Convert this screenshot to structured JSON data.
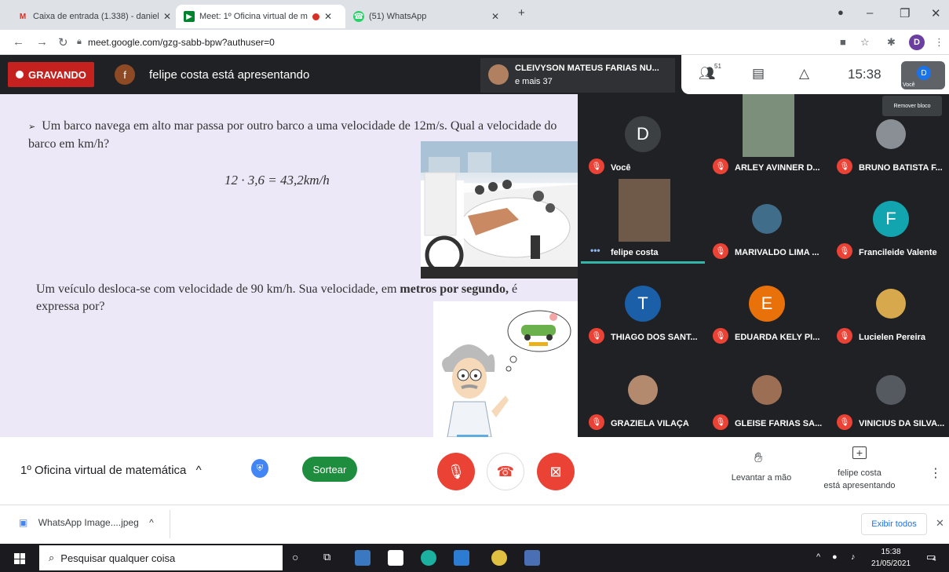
{
  "browser": {
    "tabs": [
      {
        "title": "Caixa de entrada (1.338) - daniel",
        "favicon": "gmail-icon"
      },
      {
        "title": "Meet: 1º Oficina virtual de m",
        "favicon": "meet-icon"
      },
      {
        "title": "(51) WhatsApp",
        "favicon": "whatsapp-icon"
      }
    ],
    "url": "meet.google.com/gzg-sabb-bpw?authuser=0",
    "profile_initial": "D"
  },
  "meet_top": {
    "recording_label": "GRAVANDO",
    "presenter_initial": "f",
    "presenting_text": "felipe costa está apresentando",
    "speaker_name": "CLEIVYSON MATEUS FARIAS NU...",
    "speaker_more": "e mais 37",
    "participant_count": "51",
    "clock": "15:38",
    "self_initial": "D",
    "self_label": "Você"
  },
  "slide": {
    "question1": "Um barco navega em alto mar passa por outro barco a uma velocidade de 12m/s. Qual a velocidade do barco em km/h?",
    "formula": "12 · 3,6 = 43,2km/h",
    "question2_part1": "Um veículo desloca-se com velocidade de 90 km/h. Sua velocidade, em ",
    "question2_bold": "metros por segundo,",
    "question2_part2": " é expressa por?"
  },
  "tooltip": "Remover bloco",
  "participants": [
    {
      "name": "Você",
      "initial": "D",
      "color": "#3c4043",
      "kind": "avatar",
      "muted": true
    },
    {
      "name": "ARLEY AVINNER D...",
      "kind": "video",
      "muted": true
    },
    {
      "name": "BRUNO BATISTA F...",
      "kind": "photo",
      "muted": true
    },
    {
      "name": "felipe costa",
      "kind": "video",
      "muted": false,
      "speaking": true
    },
    {
      "name": "MARIVALDO LIMA ...",
      "kind": "photo",
      "muted": true
    },
    {
      "name": "Francileide Valente",
      "initial": "F",
      "color": "#12a4af",
      "kind": "avatar",
      "muted": true
    },
    {
      "name": "THIAGO DOS SANT...",
      "initial": "T",
      "color": "#1a5fa8",
      "kind": "avatar",
      "muted": true
    },
    {
      "name": "EDUARDA KELY PI...",
      "initial": "E",
      "color": "#e8710a",
      "kind": "avatar",
      "muted": true
    },
    {
      "name": "Lucielen Pereira",
      "kind": "photo",
      "muted": true
    },
    {
      "name": "GRAZIELA VILAÇA",
      "kind": "photo",
      "muted": true
    },
    {
      "name": "GLEISE FARIAS SA...",
      "kind": "photo",
      "muted": true
    },
    {
      "name": "VINICIUS DA SILVA...",
      "kind": "photo",
      "muted": true
    }
  ],
  "controls": {
    "meeting_title": "1º Oficina virtual de matemática",
    "sortear": "Sortear",
    "raise_hand": "Levantar a mão",
    "presenting_line1": "felipe costa",
    "presenting_line2": "está apresentando"
  },
  "downloads": {
    "file": "WhatsApp Image....jpeg",
    "show_all": "Exibir todos"
  },
  "taskbar": {
    "search_placeholder": "Pesquisar qualquer coisa",
    "time": "15:38",
    "date": "21/05/2021",
    "notifications": "4"
  },
  "colors": {
    "record_red": "#c5221f",
    "meet_dark": "#202124",
    "mute_red": "#ea4335",
    "sortear_green": "#1e8e3e",
    "slide_bg": "#ece8f7"
  }
}
